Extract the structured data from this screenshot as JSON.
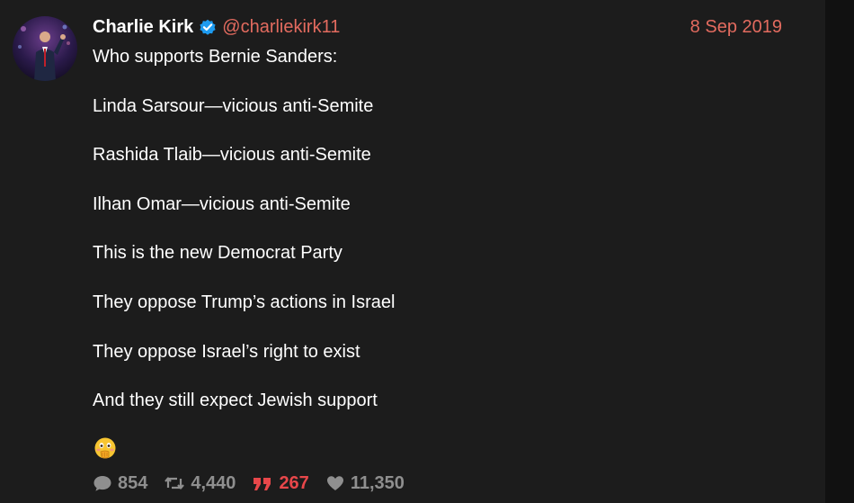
{
  "tweet": {
    "author_name": "Charlie Kirk",
    "handle": "@charliekirk11",
    "date": "8 Sep 2019",
    "lines": [
      "Who supports Bernie Sanders:",
      "Linda Sarsour—vicious anti-Semite",
      "Rashida Tlaib—vicious anti-Semite",
      "Ilhan Omar—vicious anti-Semite",
      "This is the new Democrat Party",
      "They oppose Trump’s actions in Israel",
      "They oppose Israel’s right to exist",
      "And they still expect Jewish support"
    ],
    "emoji": "flushed-face-hand-over-mouth"
  },
  "stats": {
    "replies": "854",
    "retweets": "4,440",
    "quotes": "267",
    "likes": "11,350"
  },
  "icons": {
    "verified": "verified-badge-icon",
    "reply": "speech-bubble-icon",
    "retweet": "retweet-icon",
    "quote": "quote-marks-icon",
    "like": "heart-icon"
  },
  "colors": {
    "background": "#1c1c1c",
    "accent": "#e36b5f",
    "quote_accent": "#e8474a",
    "muted": "#8f8f8f",
    "verified": "#1d9bf0"
  }
}
